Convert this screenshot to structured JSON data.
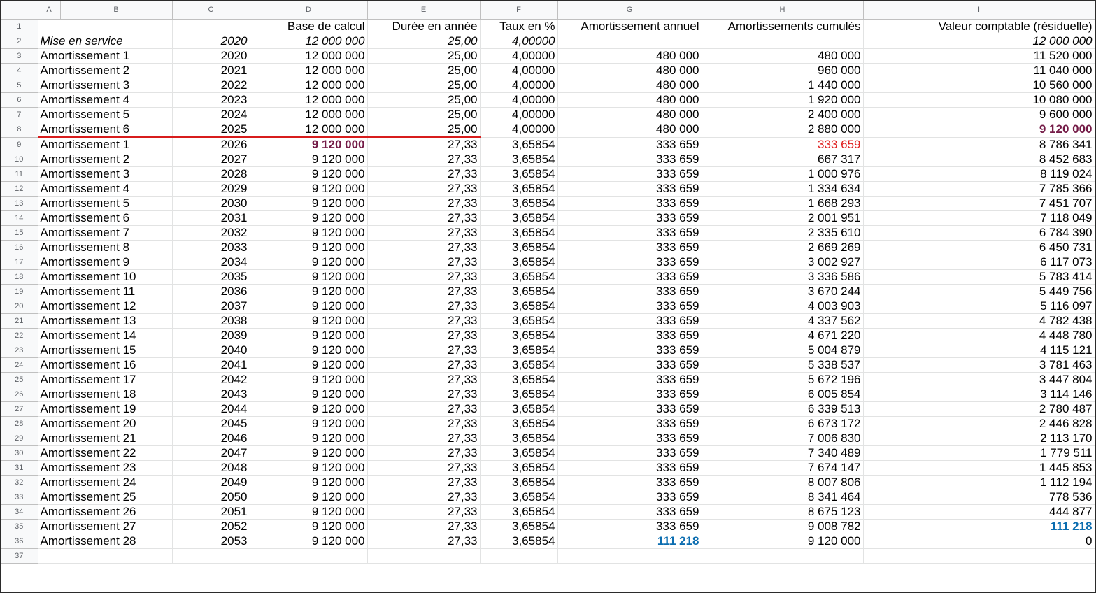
{
  "columns": [
    "A",
    "B",
    "C",
    "D",
    "E",
    "F",
    "G",
    "H",
    "I"
  ],
  "headers": {
    "base": "Base de calcul",
    "duree": "Durée en année",
    "taux": "Taux en %",
    "annuel": "Amortissement annuel",
    "cumules": "Amortissements cumulés",
    "valeur": "Valeur comptable (résiduelle)"
  },
  "service": {
    "label": "Mise en service",
    "year": "2020",
    "base": "12 000 000",
    "duree": "25,00",
    "taux": "4,00000",
    "valeur": "12 000 000"
  },
  "rows": [
    {
      "n": "3",
      "label": "Amortissement 1",
      "year": "2020",
      "base": "12 000 000",
      "duree": "25,00",
      "taux": "4,00000",
      "annuel": "480 000",
      "cumul": "480 000",
      "valeur": "11 520 000"
    },
    {
      "n": "4",
      "label": "Amortissement 2",
      "year": "2021",
      "base": "12 000 000",
      "duree": "25,00",
      "taux": "4,00000",
      "annuel": "480 000",
      "cumul": "960 000",
      "valeur": "11 040 000"
    },
    {
      "n": "5",
      "label": "Amortissement 3",
      "year": "2022",
      "base": "12 000 000",
      "duree": "25,00",
      "taux": "4,00000",
      "annuel": "480 000",
      "cumul": "1 440 000",
      "valeur": "10 560 000"
    },
    {
      "n": "6",
      "label": "Amortissement 4",
      "year": "2023",
      "base": "12 000 000",
      "duree": "25,00",
      "taux": "4,00000",
      "annuel": "480 000",
      "cumul": "1 920 000",
      "valeur": "10 080 000"
    },
    {
      "n": "7",
      "label": "Amortissement 5",
      "year": "2024",
      "base": "12 000 000",
      "duree": "25,00",
      "taux": "4,00000",
      "annuel": "480 000",
      "cumul": "2 400 000",
      "valeur": "9 600 000"
    },
    {
      "n": "8",
      "label": "Amortissement 6",
      "year": "2025",
      "base": "12 000 000",
      "duree": "25,00",
      "taux": "4,00000",
      "annuel": "480 000",
      "cumul": "2 880 000",
      "valeur": "9 120 000"
    },
    {
      "n": "9",
      "label": "Amortissement 1",
      "year": "2026",
      "base": "9 120 000",
      "duree": "27,33",
      "taux": "3,65854",
      "annuel": "333 659",
      "cumul": "333 659",
      "valeur": "8 786 341"
    },
    {
      "n": "10",
      "label": "Amortissement 2",
      "year": "2027",
      "base": "9 120 000",
      "duree": "27,33",
      "taux": "3,65854",
      "annuel": "333 659",
      "cumul": "667 317",
      "valeur": "8 452 683"
    },
    {
      "n": "11",
      "label": "Amortissement 3",
      "year": "2028",
      "base": "9 120 000",
      "duree": "27,33",
      "taux": "3,65854",
      "annuel": "333 659",
      "cumul": "1 000 976",
      "valeur": "8 119 024"
    },
    {
      "n": "12",
      "label": "Amortissement 4",
      "year": "2029",
      "base": "9 120 000",
      "duree": "27,33",
      "taux": "3,65854",
      "annuel": "333 659",
      "cumul": "1 334 634",
      "valeur": "7 785 366"
    },
    {
      "n": "13",
      "label": "Amortissement 5",
      "year": "2030",
      "base": "9 120 000",
      "duree": "27,33",
      "taux": "3,65854",
      "annuel": "333 659",
      "cumul": "1 668 293",
      "valeur": "7 451 707"
    },
    {
      "n": "14",
      "label": "Amortissement 6",
      "year": "2031",
      "base": "9 120 000",
      "duree": "27,33",
      "taux": "3,65854",
      "annuel": "333 659",
      "cumul": "2 001 951",
      "valeur": "7 118 049"
    },
    {
      "n": "15",
      "label": "Amortissement 7",
      "year": "2032",
      "base": "9 120 000",
      "duree": "27,33",
      "taux": "3,65854",
      "annuel": "333 659",
      "cumul": "2 335 610",
      "valeur": "6 784 390"
    },
    {
      "n": "16",
      "label": "Amortissement 8",
      "year": "2033",
      "base": "9 120 000",
      "duree": "27,33",
      "taux": "3,65854",
      "annuel": "333 659",
      "cumul": "2 669 269",
      "valeur": "6 450 731"
    },
    {
      "n": "17",
      "label": "Amortissement 9",
      "year": "2034",
      "base": "9 120 000",
      "duree": "27,33",
      "taux": "3,65854",
      "annuel": "333 659",
      "cumul": "3 002 927",
      "valeur": "6 117 073"
    },
    {
      "n": "18",
      "label": "Amortissement 10",
      "year": "2035",
      "base": "9 120 000",
      "duree": "27,33",
      "taux": "3,65854",
      "annuel": "333 659",
      "cumul": "3 336 586",
      "valeur": "5 783 414"
    },
    {
      "n": "19",
      "label": "Amortissement 11",
      "year": "2036",
      "base": "9 120 000",
      "duree": "27,33",
      "taux": "3,65854",
      "annuel": "333 659",
      "cumul": "3 670 244",
      "valeur": "5 449 756"
    },
    {
      "n": "20",
      "label": "Amortissement 12",
      "year": "2037",
      "base": "9 120 000",
      "duree": "27,33",
      "taux": "3,65854",
      "annuel": "333 659",
      "cumul": "4 003 903",
      "valeur": "5 116 097"
    },
    {
      "n": "21",
      "label": "Amortissement 13",
      "year": "2038",
      "base": "9 120 000",
      "duree": "27,33",
      "taux": "3,65854",
      "annuel": "333 659",
      "cumul": "4 337 562",
      "valeur": "4 782 438"
    },
    {
      "n": "22",
      "label": "Amortissement 14",
      "year": "2039",
      "base": "9 120 000",
      "duree": "27,33",
      "taux": "3,65854",
      "annuel": "333 659",
      "cumul": "4 671 220",
      "valeur": "4 448 780"
    },
    {
      "n": "23",
      "label": "Amortissement 15",
      "year": "2040",
      "base": "9 120 000",
      "duree": "27,33",
      "taux": "3,65854",
      "annuel": "333 659",
      "cumul": "5 004 879",
      "valeur": "4 115 121"
    },
    {
      "n": "24",
      "label": "Amortissement 16",
      "year": "2041",
      "base": "9 120 000",
      "duree": "27,33",
      "taux": "3,65854",
      "annuel": "333 659",
      "cumul": "5 338 537",
      "valeur": "3 781 463"
    },
    {
      "n": "25",
      "label": "Amortissement 17",
      "year": "2042",
      "base": "9 120 000",
      "duree": "27,33",
      "taux": "3,65854",
      "annuel": "333 659",
      "cumul": "5 672 196",
      "valeur": "3 447 804"
    },
    {
      "n": "26",
      "label": "Amortissement 18",
      "year": "2043",
      "base": "9 120 000",
      "duree": "27,33",
      "taux": "3,65854",
      "annuel": "333 659",
      "cumul": "6 005 854",
      "valeur": "3 114 146"
    },
    {
      "n": "27",
      "label": "Amortissement 19",
      "year": "2044",
      "base": "9 120 000",
      "duree": "27,33",
      "taux": "3,65854",
      "annuel": "333 659",
      "cumul": "6 339 513",
      "valeur": "2 780 487"
    },
    {
      "n": "28",
      "label": "Amortissement 20",
      "year": "2045",
      "base": "9 120 000",
      "duree": "27,33",
      "taux": "3,65854",
      "annuel": "333 659",
      "cumul": "6 673 172",
      "valeur": "2 446 828"
    },
    {
      "n": "29",
      "label": "Amortissement 21",
      "year": "2046",
      "base": "9 120 000",
      "duree": "27,33",
      "taux": "3,65854",
      "annuel": "333 659",
      "cumul": "7 006 830",
      "valeur": "2 113 170"
    },
    {
      "n": "30",
      "label": "Amortissement 22",
      "year": "2047",
      "base": "9 120 000",
      "duree": "27,33",
      "taux": "3,65854",
      "annuel": "333 659",
      "cumul": "7 340 489",
      "valeur": "1 779 511"
    },
    {
      "n": "31",
      "label": "Amortissement 23",
      "year": "2048",
      "base": "9 120 000",
      "duree": "27,33",
      "taux": "3,65854",
      "annuel": "333 659",
      "cumul": "7 674 147",
      "valeur": "1 445 853"
    },
    {
      "n": "32",
      "label": "Amortissement 24",
      "year": "2049",
      "base": "9 120 000",
      "duree": "27,33",
      "taux": "3,65854",
      "annuel": "333 659",
      "cumul": "8 007 806",
      "valeur": "1 112 194"
    },
    {
      "n": "33",
      "label": "Amortissement 25",
      "year": "2050",
      "base": "9 120 000",
      "duree": "27,33",
      "taux": "3,65854",
      "annuel": "333 659",
      "cumul": "8 341 464",
      "valeur": "778 536"
    },
    {
      "n": "34",
      "label": "Amortissement 26",
      "year": "2051",
      "base": "9 120 000",
      "duree": "27,33",
      "taux": "3,65854",
      "annuel": "333 659",
      "cumul": "8 675 123",
      "valeur": "444 877"
    },
    {
      "n": "35",
      "label": "Amortissement 27",
      "year": "2052",
      "base": "9 120 000",
      "duree": "27,33",
      "taux": "3,65854",
      "annuel": "333 659",
      "cumul": "9 008 782",
      "valeur": "111 218"
    },
    {
      "n": "36",
      "label": "Amortissement 28",
      "year": "2053",
      "base": "9 120 000",
      "duree": "27,33",
      "taux": "3,65854",
      "annuel": "111 218",
      "cumul": "9 120 000",
      "valeur": "0"
    }
  ],
  "colors": {
    "purple": "#741b47",
    "red": "#e02020",
    "blue": "#0b6db0",
    "redline": "#d81c1c"
  }
}
